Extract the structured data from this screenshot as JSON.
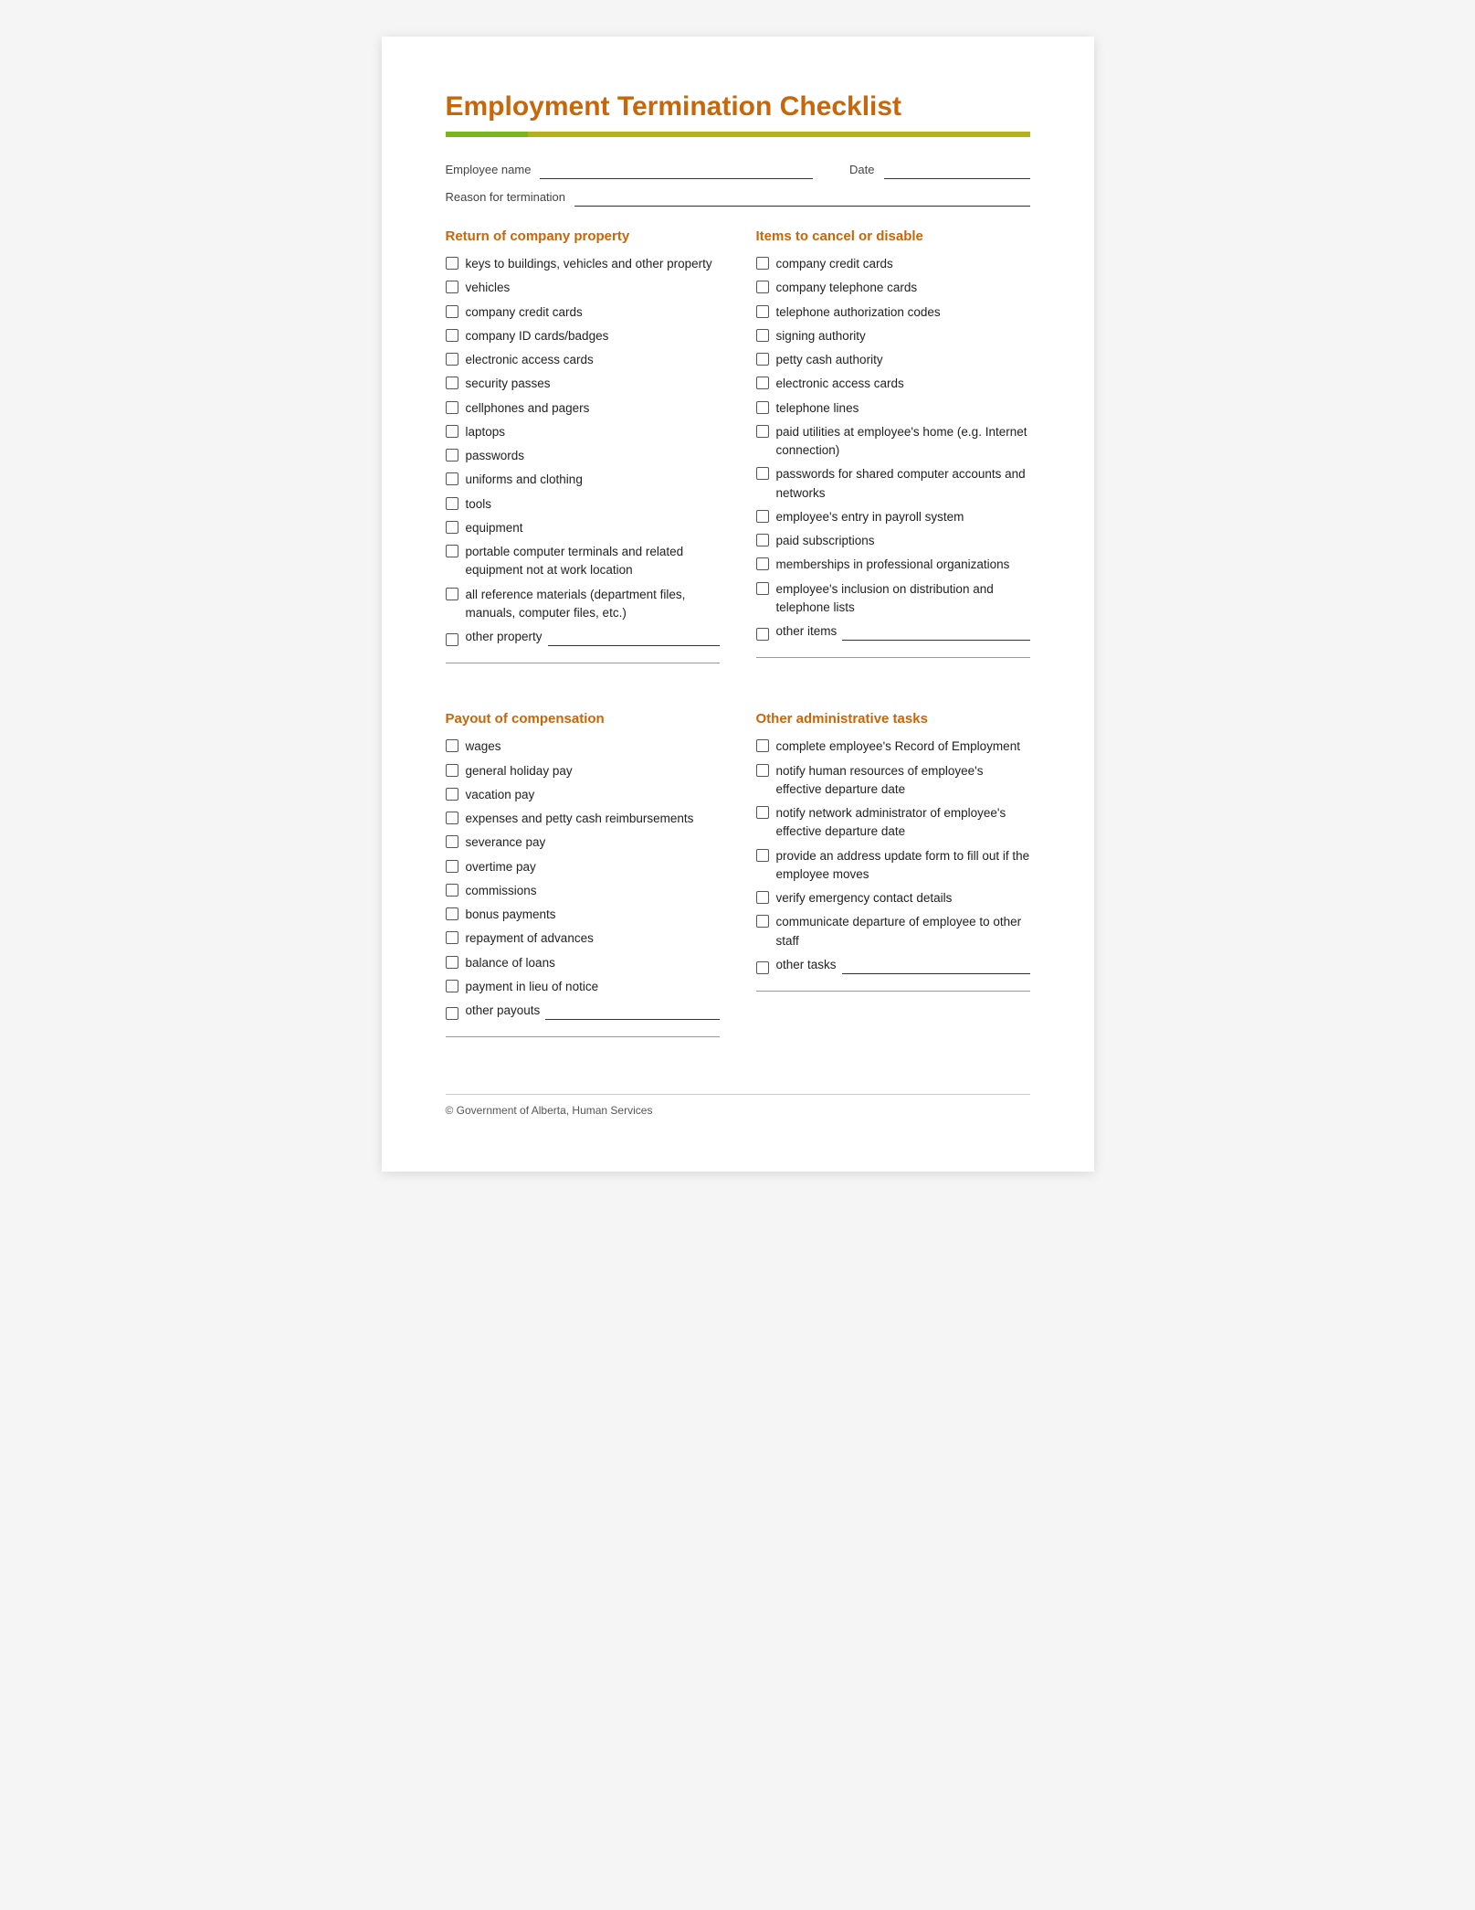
{
  "page": {
    "title": "Employment Termination Checklist",
    "footer": "© Government of Alberta, Human Services"
  },
  "form": {
    "employee_name_label": "Employee name",
    "date_label": "Date",
    "reason_label": "Reason for termination"
  },
  "sections": {
    "return_property": {
      "title": "Return of company property",
      "items": [
        "keys to buildings, vehicles and other property",
        "vehicles",
        "company credit cards",
        "company ID cards/badges",
        "electronic access cards",
        "security passes",
        "cellphones and pagers",
        "laptops",
        "passwords",
        "uniforms and clothing",
        "tools",
        "equipment",
        "portable computer terminals and related equipment not at work location",
        "all reference materials (department files, manuals, computer files, etc.)",
        "other property"
      ]
    },
    "cancel_disable": {
      "title": "Items to cancel or disable",
      "items": [
        "company credit cards",
        "company telephone cards",
        "telephone authorization codes",
        "signing authority",
        "petty cash authority",
        "electronic access cards",
        "telephone lines",
        "paid utilities at employee's home (e.g. Internet connection)",
        "passwords for shared computer accounts and networks",
        "employee's entry in payroll system",
        "paid subscriptions",
        "memberships in professional organizations",
        "employee's inclusion on distribution and telephone lists",
        "other items"
      ]
    },
    "payout": {
      "title": "Payout of compensation",
      "items": [
        "wages",
        "general holiday pay",
        "vacation pay",
        "expenses and petty cash reimbursements",
        "severance pay",
        "overtime pay",
        "commissions",
        "bonus payments",
        "repayment of advances",
        "balance of loans",
        "payment in lieu of notice",
        "other payouts"
      ]
    },
    "admin_tasks": {
      "title": "Other administrative tasks",
      "items": [
        "complete employee's Record of Employment",
        "notify human resources of employee's effective departure date",
        "notify network administrator of employee's effective departure date",
        "provide an address update form to fill out if the employee moves",
        "verify emergency contact details",
        "communicate departure of employee to other staff",
        "other tasks"
      ]
    }
  }
}
